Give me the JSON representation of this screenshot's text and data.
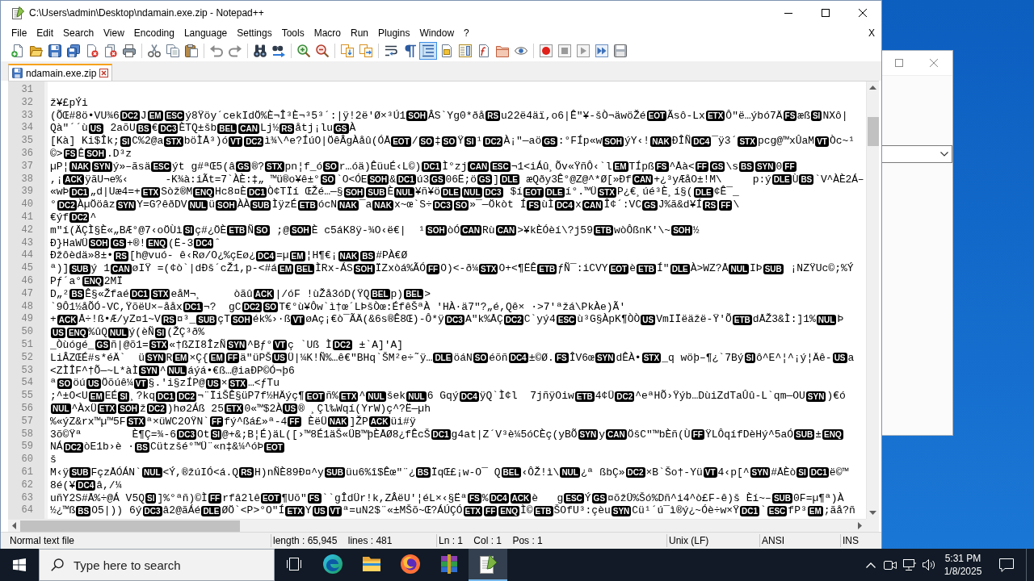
{
  "window": {
    "title": "C:\\Users\\admin\\Desktop\\ndamain.exe.zip - Notepad++"
  },
  "menu": {
    "items": [
      "File",
      "Edit",
      "Search",
      "View",
      "Encoding",
      "Language",
      "Settings",
      "Tools",
      "Macro",
      "Run",
      "Plugins",
      "Window",
      "?"
    ],
    "close_label": "X"
  },
  "toolbar": [
    [
      {
        "kind": "new",
        "on": false
      },
      {
        "kind": "open",
        "on": false
      },
      {
        "kind": "save",
        "on": false
      },
      {
        "kind": "saveall",
        "on": false
      },
      {
        "kind": "close",
        "on": false
      },
      {
        "kind": "closeall",
        "on": false
      },
      {
        "kind": "print",
        "on": false
      }
    ],
    [
      {
        "kind": "cut",
        "on": false
      },
      {
        "kind": "copy",
        "on": false
      },
      {
        "kind": "paste",
        "on": false
      }
    ],
    [
      {
        "kind": "undo",
        "on": false
      },
      {
        "kind": "redo",
        "on": false
      }
    ],
    [
      {
        "kind": "find",
        "on": false
      },
      {
        "kind": "replace",
        "on": false
      }
    ],
    [
      {
        "kind": "zoomin",
        "on": false
      },
      {
        "kind": "zoomout",
        "on": false
      }
    ],
    [
      {
        "kind": "syncv",
        "on": false
      },
      {
        "kind": "synch",
        "on": false
      }
    ],
    [
      {
        "kind": "wrap",
        "on": false
      },
      {
        "kind": "allchars",
        "on": false
      },
      {
        "kind": "indent",
        "on": true
      },
      {
        "kind": "udl",
        "on": false
      },
      {
        "kind": "docmap",
        "on": false
      },
      {
        "kind": "funclist",
        "on": false
      },
      {
        "kind": "workspace",
        "on": false
      },
      {
        "kind": "monitor",
        "on": false
      }
    ],
    [
      {
        "kind": "record",
        "on": false
      },
      {
        "kind": "stop",
        "on": false
      },
      {
        "kind": "play",
        "on": false
      },
      {
        "kind": "playmulti",
        "on": false
      },
      {
        "kind": "savemacro",
        "on": false
      }
    ]
  ],
  "tabs": [
    {
      "label": "ndamain.exe.zip",
      "selected": true
    }
  ],
  "editor": {
    "lines": [
      {
        "number": "31"
      },
      {
        "number": "32",
        "segments": [
          "ž¥£pÝi"
        ]
      },
      {
        "number": "33",
        "segments": [
          "(ÕŒ#8ö•VU¾6",
          [
            "DC2"
          ],
          "J",
          [
            "EM"
          ],
          [
            "ESC"
          ],
          "ý8Ÿöy´cekIdÖ%È¬Î³È¬³5³´:|ÿ!2ë'Ø×³Ú1",
          [
            "SOH"
          ],
          "ÂS`Yg0*ðå",
          [
            "RS"
          ],
          "u22ë4äï,o6|Ê\"¥-šÒ¬äwöŽé",
          [
            "EOT"
          ],
          "Ãsô-Lx",
          [
            "ETX"
          ],
          "Ô″ë…ýbó7Ä",
          [
            "FS"
          ],
          "æß",
          [
            "SI"
          ],
          "NXô|"
        ]
      },
      {
        "number": "34",
        "segments": [
          "Qà\"´´ù",
          [
            "US"
          ],
          " 2aõU",
          [
            "BS"
          ],
          "€",
          [
            "DC3"
          ],
          "ÈTQ±šb",
          [
            "BEL"
          ],
          [
            "CAN"
          ],
          "Lj½",
          [
            "RS"
          ],
          "åtj¡lu",
          [
            "GS"
          ],
          "À"
        ]
      },
      {
        "number": "35",
        "segments": [
          "[Kà] Ki$Îk;",
          [
            "SI"
          ],
          "C%2@a",
          [
            "STX"
          ],
          "böÌÅ³)ó",
          [
            "VT"
          ],
          [
            "DC2"
          ],
          "ì¾\\^e?ÍúO|ÖêÂgÀåû(ÓÅ",
          [
            "EOT"
          ],
          "/",
          [
            "SO"
          ],
          "‡",
          [
            "SO"
          ],
          "Ÿ",
          [
            "SI"
          ],
          "¹",
          [
            "DC2"
          ],
          "À¡\"—aö",
          [
            "GS"
          ],
          ":°FÍp«w",
          [
            "SOH"
          ],
          "ýY‹!",
          [
            "NAK"
          ],
          "ÐÎÑ",
          [
            "DC4"
          ],
          "¯ÿ3´",
          [
            "STX"
          ],
          "pcg@™xÛaM",
          [
            "VT"
          ],
          "Òc~¹"
        ]
      },
      {
        "number": "36",
        "segments": [
          "©>",
          [
            "FS"
          ],
          "Ê",
          [
            "SOH"
          ],
          ".D³z"
        ]
      },
      {
        "number": "37",
        "segments": [
          "µP¦",
          [
            "NAK"
          ],
          [
            "SYN"
          ],
          "ý»–ãsä",
          [
            "ESC"
          ],
          "ýt g#ªŒ5(â",
          [
            "GS"
          ],
          "®?",
          [
            "STX"
          ],
          "pn¦f_ó",
          [
            "SO"
          ],
          "r…óä)ÊüuÉ‹L©)",
          [
            "DC1"
          ],
          "Ì°zj",
          [
            "CAN"
          ],
          [
            "ESC"
          ],
          "¬1<iÁû¸Õv«ŸñÔ‹`l",
          [
            "EM"
          ],
          "TÍpß",
          [
            "FS"
          ],
          "^Åà<",
          [
            "FF"
          ],
          [
            "GS"
          ],
          "\\s",
          [
            "BS"
          ],
          [
            "SYN"
          ],
          "0",
          [
            "FF"
          ]
        ]
      },
      {
        "number": "38",
        "segments": [
          ",¡",
          [
            "ACK"
          ],
          "ÿãU¬e%‹      -K¾à:iÃt=7`ÀÈ:‡„ ™ü®o¥ê±°",
          [
            "SO"
          ],
          "`O<ÓE",
          [
            "SOH"
          ],
          "&",
          [
            "DC1"
          ],
          "ú3",
          [
            "GS"
          ],
          "06Ë;ö",
          [
            "GS"
          ],
          "]",
          [
            "DLE"
          ],
          " æQðy3Ê°@Z@^*Ø[»Ðf",
          [
            "CAN"
          ],
          "+¿³yÆåO±!M\\     p:ý",
          [
            "DLE"
          ],
          "Ù",
          [
            "BS"
          ],
          "`V^ÀÈ2Á–"
        ]
      },
      {
        "number": "39",
        "segments": [
          "«wÞ",
          [
            "DC1"
          ],
          "„d|Uæ4=+",
          [
            "ETX"
          ],
          "Sòž®M",
          [
            "ENQ"
          ],
          "Hc8¤È",
          [
            "DC1"
          ],
          "Ò¢TÏí ŒŽé…—§",
          [
            "SOH"
          ],
          [
            "SUB"
          ],
          "È",
          [
            "NUL"
          ],
          "¥ñ¥ö",
          [
            "DLE"
          ],
          [
            "NUL"
          ],
          [
            "DC3"
          ],
          " $í",
          [
            "EOT"
          ],
          [
            "DLE"
          ],
          "í°.™Ü",
          [
            "STX"
          ],
          "P¿€¸úé³È¸í§(",
          [
            "DLE"
          ],
          "¢Ê¯_"
        ]
      },
      {
        "number": "40",
        "segments": [
          "°",
          [
            "DC2"
          ],
          "ÀµÖöâz",
          [
            "SYN"
          ],
          "Y=G?êðDV",
          [
            "NUL"
          ],
          "ü",
          [
            "SOH"
          ],
          "ÀÀ",
          [
            "SUB"
          ],
          "ÌÿzÉ",
          [
            "ETB"
          ],
          "ócN",
          [
            "NAK"
          ],
          "¯a",
          [
            "NAK"
          ],
          "x~œ`S÷",
          [
            "DC3"
          ],
          [
            "SO"
          ],
          "»¯—Ökòt Í",
          [
            "FS"
          ],
          "ùÌ",
          [
            "DC4"
          ],
          "x",
          [
            "CAN"
          ],
          "Î¢´:VC",
          [
            "GS"
          ],
          "J%ã&d¥Í",
          [
            "RS"
          ],
          [
            "FF"
          ],
          "\\"
        ]
      },
      {
        "number": "41",
        "segments": [
          "€ýf",
          [
            "DC2"
          ],
          "^"
        ]
      },
      {
        "number": "42",
        "segments": [
          "m\"í(ÄÇÌ§È«„BÆ°@7‹oÖÙì",
          [
            "SI"
          ],
          "ç#¿ÖÈ",
          [
            "ETB"
          ],
          "Ñ",
          [
            "SO"
          ],
          " ;@",
          [
            "SOH"
          ],
          "È c5áK8ÿ-¾O‹ë€|  ¹",
          [
            "SOH"
          ],
          "òÓ",
          [
            "CAN"
          ],
          "Rù",
          [
            "CAN"
          ],
          ">¥kÈÓèí\\?j59",
          [
            "ETB"
          ],
          "wòÔßnK'\\~",
          [
            "SOH"
          ],
          "½"
        ]
      },
      {
        "number": "43",
        "segments": [
          "Ð}HaWÜ",
          [
            "SOH"
          ],
          [
            "GS"
          ],
          "+®!",
          [
            "ENQ"
          ],
          "(Ë-3",
          [
            "DC4"
          ],
          "ˆ"
        ]
      },
      {
        "number": "44",
        "segments": [
          "Ðžôèdä»8±•",
          [
            "RS"
          ],
          "[h@vuó- ê‹Rø/O¿%çEø¿",
          [
            "DC4"
          ],
          "=µ",
          [
            "EM"
          ],
          "¦H¶€¡",
          [
            "NAK"
          ],
          [
            "BS"
          ],
          "#PÀ€Ø"
        ]
      },
      {
        "number": "45",
        "segments": [
          "ª)]",
          [
            "SUB"
          ],
          "ý 1",
          [
            "CAN"
          ],
          "øIŸ =(¢ò`|dÐš´cŽ1,p-<#á",
          [
            "EM"
          ],
          [
            "BEL"
          ],
          "ÌRx-ÁS",
          [
            "SOH"
          ],
          "ÏZxòá%ÃÓ",
          [
            "FF"
          ],
          "O)<-ð¼",
          [
            "STX"
          ],
          "O+<¶ËÊ",
          [
            "ETB"
          ],
          "ƒÑ¯:iCVY",
          [
            "EOT"
          ],
          "è",
          [
            "ETB"
          ],
          "Í\"",
          [
            "DLE"
          ],
          "À>WZ?Å",
          [
            "NUL"
          ],
          "IÞ",
          [
            "SUB"
          ],
          " ¡NZŸUc©;%Ý"
        ]
      },
      {
        "number": "46",
        "segments": [
          "Pƒ´a°",
          [
            "ENQ"
          ],
          "2MÏ"
        ]
      },
      {
        "number": "47",
        "segments": [
          "D„²",
          [
            "BS"
          ],
          "Ê§«Žfaé",
          [
            "DC1"
          ],
          [
            "STX"
          ],
          "eåM¬¸     òãû",
          [
            "ACK"
          ],
          "|/óF !ùŽå3óD(ŸQ",
          [
            "BEL"
          ],
          "p)",
          [
            "BEL"
          ],
          ">"
        ]
      },
      {
        "number": "48",
        "segments": [
          "`9Ô1½åÕÓ-VC,ŸõëU×–ååx",
          [
            "DC1"
          ],
          "¬?  gC",
          [
            "DC2"
          ],
          [
            "SO"
          ],
          "T€°ù¥Ôw`ì†œ´LÞšÒœ:ÉfêŠªÀ 'HÀ·ä7\"?„é,Qê× ·>7'ªžá\\PkÀe)Ã'"
        ]
      },
      {
        "number": "49",
        "segments": [
          "+",
          [
            "ACK"
          ],
          "Å÷!ß•Æ/yZ¤1~V",
          [
            "RS"
          ],
          "¤³_",
          [
            "SUB"
          ],
          "çT",
          [
            "SOH"
          ],
          "ék%›·ß",
          [
            "VT"
          ],
          "øAç¡€ò¯ÃÄ(&6s®Ê8Œ)-Ô*ÿ",
          [
            "DC3"
          ],
          "A\"k%ÅÇ",
          [
            "DC2"
          ],
          "C`yý4",
          [
            "ESC"
          ],
          "ù³G§ÀpK¶ÒÒ",
          [
            "US"
          ],
          "VmIÏëäžë-Ÿ'Õ",
          [
            "ETB"
          ],
          "dÅŽ3&Ì:]1%",
          [
            "NUL"
          ],
          "Þ"
        ]
      },
      {
        "number": "50",
        "segments": [
          [
            "US"
          ],
          [
            "ENQ"
          ],
          "%ûQ",
          [
            "NUL"
          ],
          "ý(èÑ",
          [
            "SI"
          ],
          "(ŽÇ³ð%"
        ]
      },
      {
        "number": "51",
        "segments": [
          "_Òùógé_",
          [
            "GS"
          ],
          "ñ|@õ1=",
          [
            "STX"
          ],
          "«†ßZI8ÎzÑ",
          [
            "SYN"
          ],
          "^Bƒ°",
          [
            "VT"
          ],
          "ç `Uß Ì",
          [
            "DC2"
          ],
          " ±`A]'A]"
        ]
      },
      {
        "number": "52",
        "segments": [
          "LiÂZŒÉ#s*éÄ`  ü",
          [
            "SYN"
          ],
          "R",
          [
            "EM"
          ],
          "×Ç{",
          [
            "EM"
          ],
          [
            "FF"
          ],
          "ä\"üPŠ",
          [
            "US"
          ],
          "Ü|¼K!Ñ%…ê€″BHq`ŠM²e÷˜ÿ…",
          [
            "DLE"
          ],
          "öáN",
          [
            "SO"
          ],
          "éõñ",
          [
            "DC4"
          ],
          "±©Ø.",
          [
            "FS"
          ],
          "ÎV6œ",
          [
            "SYN"
          ],
          "dÊÀ•",
          [
            "STX"
          ],
          "_q wöþ–¶¿`7Bý",
          [
            "SI"
          ],
          "ô^E^¦^¡ý¦Äê-",
          [
            "US"
          ],
          "a"
        ]
      },
      {
        "number": "53",
        "segments": [
          "<ZÌÎF^†Õ—~L*àÌ",
          [
            "SYN"
          ],
          "^",
          [
            "NUL"
          ],
          "áýá•€ß…@iaÐP©Ó¬þ6"
        ]
      },
      {
        "number": "54",
        "segments": [
          "ª",
          [
            "SO"
          ],
          "öú",
          [
            "US"
          ],
          "Öõúê¼",
          [
            "VT"
          ],
          "§.'i§zÍP@",
          [
            "US"
          ],
          "×",
          [
            "STX"
          ],
          "…<ƒTu"
        ]
      },
      {
        "number": "55",
        "segments": [
          ";^±O<U",
          [
            "EM"
          ],
          "EÉ",
          [
            "SI"
          ],
          "¸?kq",
          [
            "DC1"
          ],
          [
            "DC2"
          ],
          "¬¨ÏiŠÊ§üP7f½HÄýç¶",
          [
            "EOT"
          ],
          "ñ%",
          [
            "ETX"
          ],
          "^",
          [
            "NUL"
          ],
          "šek",
          [
            "NUL"
          ],
          "6 Gqý",
          [
            "DC4"
          ],
          "ÿQ`Ì¢l  7jñÿOiw",
          [
            "ETB"
          ],
          "4¢Ü",
          [
            "DC2"
          ],
          "^eªHÕ›Ÿýb…DùiZdTaÛû-L`qm—OU",
          [
            "SYN"
          ],
          ")€ó"
        ]
      },
      {
        "number": "56",
        "segments": [
          [
            "NUL"
          ],
          "^ÀxÜ",
          [
            "ETX"
          ],
          [
            "SOH"
          ],
          "ž",
          [
            "DC2"
          ],
          ")hø2Áß 25",
          [
            "ETX"
          ],
          "0«™$2À",
          [
            "US"
          ],
          "® ¸Çl‰Wqí(YrW)ç^?Ë—µh"
        ]
      },
      {
        "number": "57",
        "segments": [
          "%«ýZ&rx™µ™5F",
          [
            "STX"
          ],
          "ª×üWC2OŸN`",
          [
            "FF"
          ],
          "fý^ßá£»ª-4",
          [
            "FF"
          ],
          " ÈëÜ",
          [
            "NAK"
          ],
          "]ŽP",
          [
            "ACK"
          ],
          "üi#ÿ"
        ]
      },
      {
        "number": "58",
        "segments": [
          "3õ©Ÿª        È¶Ç=¾-6",
          [
            "DC3"
          ],
          "Ot",
          [
            "SI"
          ],
          "@+&;B¦É)äL([›™8É1äŠ«ÜB™þÈÅØ8¿fÊcŠ",
          [
            "DC1"
          ],
          "g4at|Z´V³è¼5óCÈç(yBÕ",
          [
            "SYN"
          ],
          "y",
          [
            "CAN"
          ],
          "ÖšC″™bÈñ(Ù",
          [
            "FF"
          ],
          "ŸLÔqífDèHý^5aÓ",
          [
            "SUB"
          ],
          "±",
          [
            "ENQ"
          ]
        ]
      },
      {
        "number": "59",
        "segments": [
          "NÁ",
          [
            "DC2"
          ],
          "òE1b›è ·",
          [
            "BS"
          ],
          "Cützšé°™Ü¨«n‡&¼^óÞ",
          [
            "EOT"
          ]
        ]
      },
      {
        "number": "60",
        "segments": [
          "š"
        ]
      },
      {
        "number": "61",
        "segments": [
          "M‹ÿ",
          [
            "SUB"
          ],
          "FçzÅÓÁN`",
          [
            "NUL"
          ],
          "<Ý,®žúIÓ<á.Q",
          [
            "RS"
          ],
          "H)nÑÈ89Ð¤^y",
          [
            "SUB"
          ],
          "üu6%î$Êœ\"¨¿",
          [
            "BS"
          ],
          "ÏqŒ£¡w-O¯ Q",
          [
            "BEL"
          ],
          "‹ÔŽ!ì\\",
          [
            "NUL"
          ],
          "¿ª ßbÇ»",
          [
            "DC2"
          ],
          "×B`Šo†-Yü",
          [
            "VT"
          ],
          "4‹p[^",
          [
            "SYN"
          ],
          "#ÅÈò",
          [
            "SI"
          ],
          [
            "DC1"
          ],
          "ë©™"
        ]
      },
      {
        "number": "62",
        "segments": [
          "8é(¥",
          [
            "DC4"
          ],
          "â,/¼"
        ]
      },
      {
        "number": "63",
        "segments": [
          "uñY2S#Å%÷@Á V5Q",
          [
            "SI"
          ],
          "]%°ªñ)©Ì",
          [
            "FF"
          ],
          "rfâ2lê",
          [
            "EOT"
          ],
          "¶Uõ″",
          [
            "FS"
          ],
          "``gÎdÜr!k,ZÂëU'¦éL×‹§Ëª",
          [
            "FS"
          ],
          "%",
          [
            "DC4"
          ],
          [
            "ACK"
          ],
          "è   g",
          [
            "ESC"
          ],
          "Ý",
          [
            "GS"
          ],
          "¤õžÜ%Šó%Dñ^i4^ò£F-ê)š Èí~–",
          [
            "SUB"
          ],
          "0F=µ¶ª)À"
        ]
      },
      {
        "number": "64",
        "segments": [
          "½¿™ß",
          [
            "BS"
          ],
          "O5|)) 6ý",
          [
            "DC3"
          ],
          "â2@ãÁé",
          [
            "DLE"
          ],
          "ØÖ`<P>°O\"Í",
          [
            "ETX"
          ],
          "Y",
          [
            "US"
          ],
          [
            "VT"
          ],
          "ª=uN2$¨«±MŠõ~Œ?ÁÚÇÓ",
          [
            "ETX"
          ],
          [
            "FF"
          ],
          [
            "ENQ"
          ],
          "Ì©",
          [
            "ETB"
          ],
          "ŠOfU³:çèu",
          [
            "SYN"
          ],
          "Cü¹´ú¯ì®ý¿~Óè÷w×Ÿ",
          [
            "DC1"
          ],
          "`",
          [
            "ESC"
          ],
          "fP³",
          [
            "EM"
          ],
          ";ãå?ñ"
        ]
      }
    ]
  },
  "status_bar": {
    "file_type": "Normal text file",
    "length": "length : 65,945    lines : 481",
    "position": "Ln : 1    Col : 1    Pos : 1",
    "eol": "Unix (LF)",
    "encoding": "ANSI",
    "mode": "INS"
  },
  "taskbar": {
    "search": {
      "placeholder": "Type here to search"
    },
    "apps": [
      {
        "kind": "edge",
        "selected": false
      },
      {
        "kind": "explorer",
        "selected": false
      },
      {
        "kind": "firefox",
        "selected": false
      },
      {
        "kind": "archiver",
        "selected": false
      },
      {
        "kind": "notepad",
        "selected": true
      }
    ],
    "time": "5:31 PM",
    "date": "1/8/2025"
  }
}
